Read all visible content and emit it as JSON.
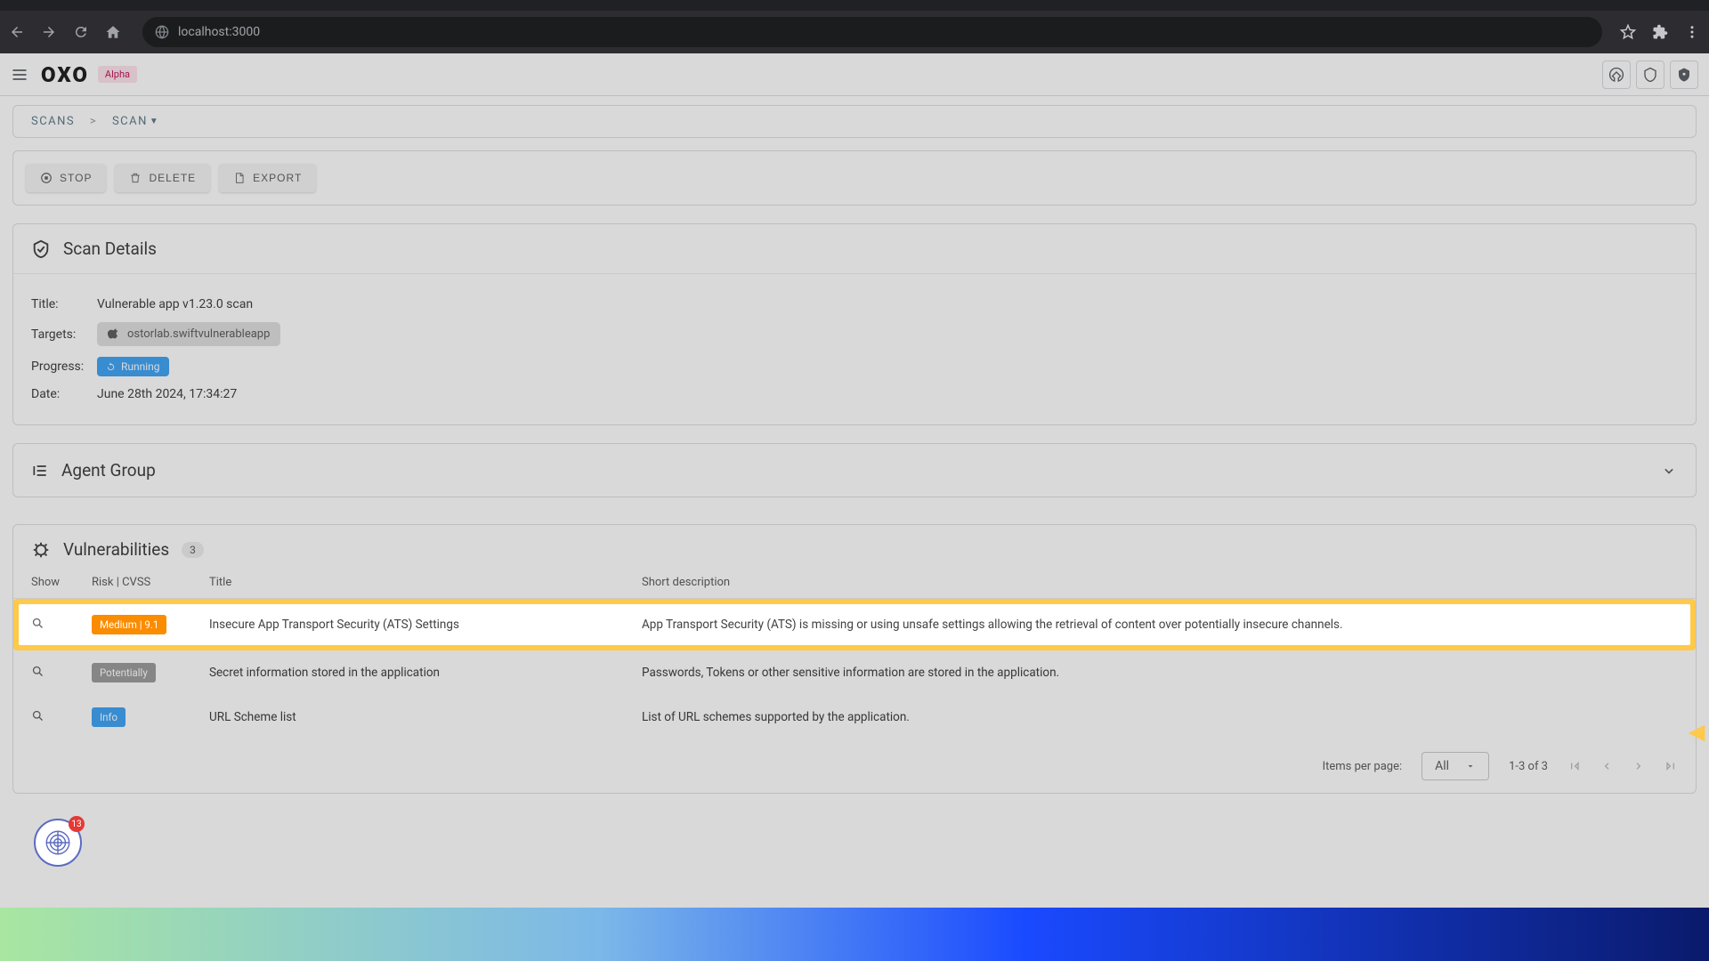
{
  "browser": {
    "url": "localhost:3000"
  },
  "header": {
    "logo": "OXO",
    "badge": "Alpha"
  },
  "breadcrumb": {
    "root": "SCANS",
    "current": "SCAN"
  },
  "actions": {
    "stop": "STOP",
    "delete": "DELETE",
    "export": "EXPORT"
  },
  "scan_details": {
    "heading": "Scan Details",
    "title_label": "Title:",
    "title_value": "Vulnerable app v1.23.0 scan",
    "targets_label": "Targets:",
    "target_value": "ostorlab.swiftvulnerableapp",
    "progress_label": "Progress:",
    "progress_value": "Running",
    "date_label": "Date:",
    "date_value": "June 28th 2024, 17:34:27"
  },
  "agent_group": {
    "heading": "Agent Group"
  },
  "vulns": {
    "heading": "Vulnerabilities",
    "count": "3",
    "cols": {
      "show": "Show",
      "risk": "Risk | CVSS",
      "title": "Title",
      "desc": "Short description"
    },
    "rows": [
      {
        "risk_label": "Medium  |  9.1",
        "risk_class": "risk-medium",
        "title": "Insecure App Transport Security (ATS) Settings",
        "desc": "App Transport Security (ATS) is missing or using unsafe settings allowing the retrieval of content over potentially insecure channels."
      },
      {
        "risk_label": "Potentially",
        "risk_class": "risk-pot",
        "title": "Secret information stored in the application",
        "desc": "Passwords, Tokens or other sensitive information are stored in the application."
      },
      {
        "risk_label": "Info",
        "risk_class": "risk-info",
        "title": "URL Scheme list",
        "desc": "List of URL schemes supported by the application."
      }
    ]
  },
  "pagination": {
    "items_label": "Items per page:",
    "per_page": "All",
    "range": "1-3 of 3"
  },
  "float_badge": {
    "count": "13"
  }
}
